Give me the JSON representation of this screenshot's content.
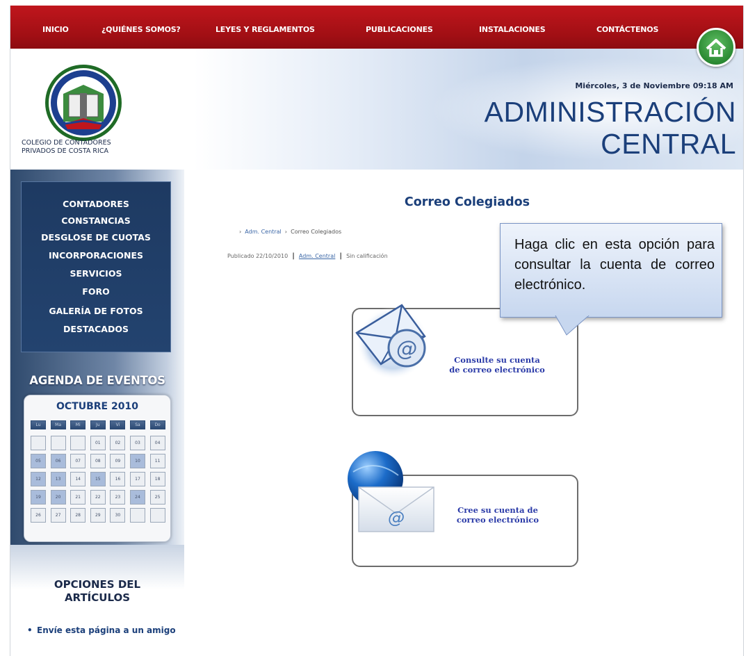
{
  "nav": {
    "items": [
      "INICIO",
      "¿QUIÉNES SOMOS?",
      "LEYES Y REGLAMENTOS",
      "PUBLICACIONES",
      "INSTALACIONES",
      "CONTÁCTENOS"
    ]
  },
  "header": {
    "org_name_line1": "COLEGIO DE CONTADORES",
    "org_name_line2": "PRIVADOS DE COSTA RICA",
    "date": "Miércoles, 3 de Noviembre 09:18 AM",
    "title_line1": "ADMINISTRACIÓN",
    "title_line2": "CENTRAL"
  },
  "sidebar": {
    "menu": [
      "CONTADORES",
      "CONSTANCIAS",
      "DESGLOSE DE CUOTAS",
      "INCORPORACIONES",
      "SERVICIOS",
      "FORO",
      "GALERÍA DE FOTOS",
      "DESTACADOS"
    ],
    "agenda_title": "AGENDA DE EVENTOS",
    "calendar": {
      "month": "OCTUBRE 2010",
      "weekdays": [
        "Lu",
        "Ma",
        "Mi",
        "Ju",
        "Vi",
        "Sa",
        "Do"
      ],
      "weeks": [
        [
          "",
          "",
          "",
          "01",
          "02",
          "03",
          "04"
        ],
        [
          "05",
          "06",
          "07",
          "08",
          "09",
          "10",
          "11"
        ],
        [
          "12",
          "13",
          "14",
          "15",
          "16",
          "17",
          "18"
        ],
        [
          "19",
          "20",
          "21",
          "22",
          "23",
          "24",
          "25"
        ],
        [
          "26",
          "27",
          "28",
          "29",
          "30",
          "",
          ""
        ]
      ],
      "highlighted": [
        "05",
        "06",
        "10",
        "12",
        "13",
        "15",
        "19",
        "20",
        "24"
      ]
    },
    "options_title_line1": "OPCIONES DEL",
    "options_title_line2": "ARTÍCULOS",
    "options_link": "Envíe esta página a un amigo"
  },
  "main": {
    "title": "Correo Colegiados",
    "breadcrumb_link": "Adm. Central",
    "breadcrumb_current": "Correo Colegiados",
    "meta_published": "Publicado 22/10/2010",
    "meta_author": "Adm. Central",
    "meta_rating": "Sin calificación",
    "card1_line1": "Consulte su cuenta",
    "card1_line2": "de correo electrónico",
    "card2_line1": "Cree su cuenta de",
    "card2_line2": "correo electrónico"
  },
  "callout": {
    "text": "Haga clic en esta opción para consultar la cuenta de correo electrónico."
  },
  "colors": {
    "nav_red": "#b01218",
    "brand_blue": "#1b3f7a",
    "link_blue": "#2b3ba8",
    "sidebar_blue": "#1e3a62",
    "home_green": "#2b8a33"
  }
}
